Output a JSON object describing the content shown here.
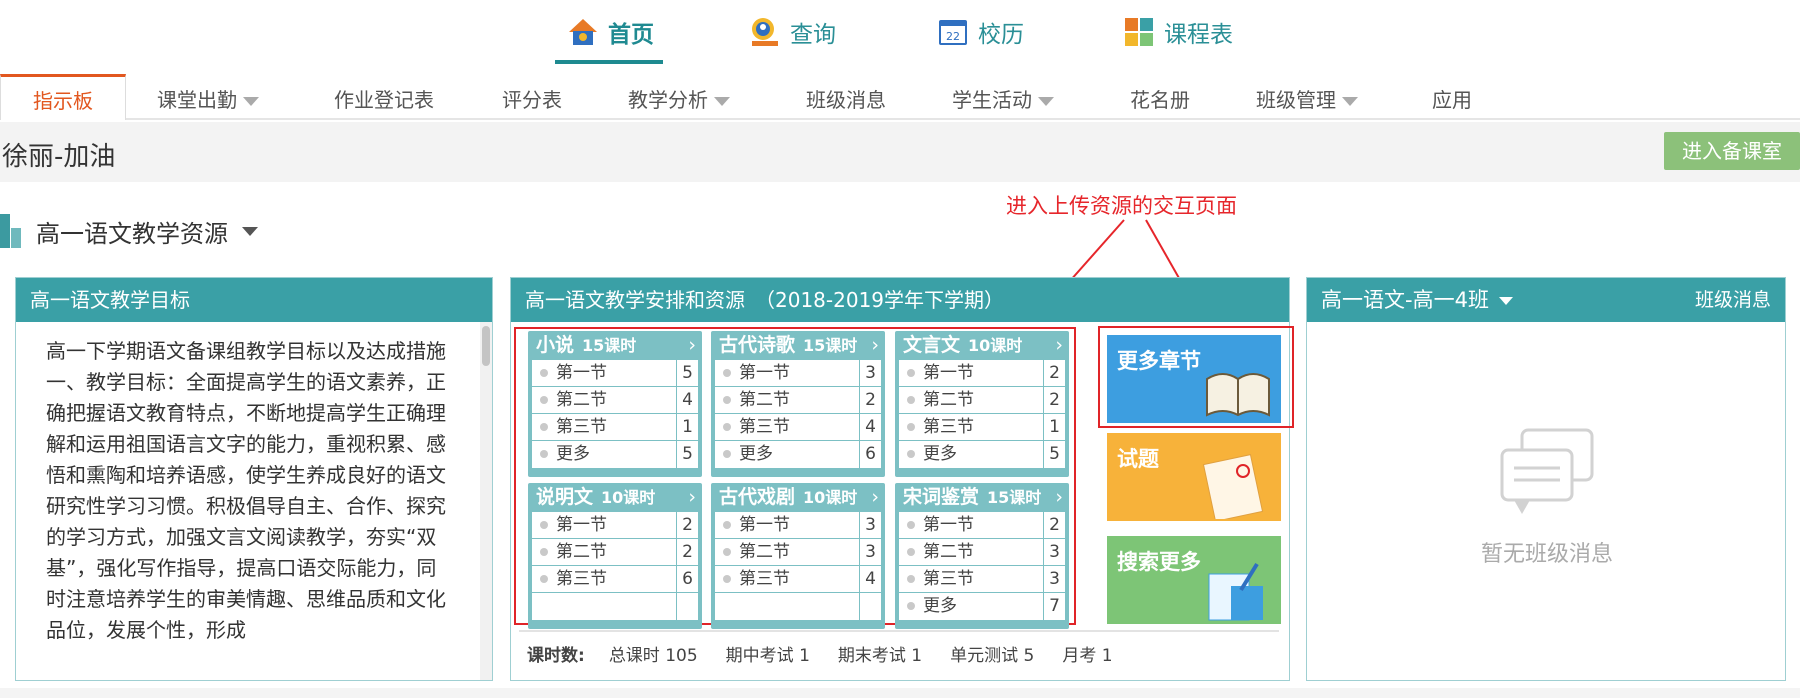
{
  "top_nav": [
    {
      "label": "首页",
      "icon": "home-icon",
      "active": true
    },
    {
      "label": "查询",
      "icon": "search-person-icon",
      "active": false
    },
    {
      "label": "校历",
      "icon": "calendar-icon",
      "active": false
    },
    {
      "label": "课程表",
      "icon": "schedule-icon",
      "active": false
    }
  ],
  "tabs": [
    {
      "label": "指示板",
      "active": true
    },
    {
      "label": "课堂出勤",
      "dropdown": true
    },
    {
      "label": "作业登记表"
    },
    {
      "label": "评分表"
    },
    {
      "label": "教学分析",
      "dropdown": true
    },
    {
      "label": "班级消息"
    },
    {
      "label": "学生活动",
      "dropdown": true
    },
    {
      "label": "花名册"
    },
    {
      "label": "班级管理",
      "dropdown": true
    },
    {
      "label": "应用"
    }
  ],
  "page_title": "徐丽-加油",
  "prep_button": "进入备课室",
  "resource_title": "高一语文教学资源",
  "annotation": "进入上传资源的交互页面",
  "goals_panel": {
    "title": "高一语文教学目标",
    "text": "高一下学期语文备课组教学目标以及达成措施\n一、教学目标：全面提高学生的语文素养，正确把握语文教育特点，不断地提高学生正确理解和运用祖国语言文字的能力，重视积累、感悟和熏陶和培养语感，使学生养成良好的语文研究性学习习惯。积极倡导自主、合作、探究的学习方式，加强文言文阅读教学，夯实“双基”，强化写作指导，提高口语交际能力，同时注意培养学生的审美情趣、思维品质和文化品位，发展个性，形成"
  },
  "plan_panel": {
    "title": "高一语文教学安排和资源　（2018-2019学年下学期）",
    "courses": [
      {
        "name": "小说",
        "hours": "15课时",
        "rows": [
          {
            "n": "第一节",
            "c": "5"
          },
          {
            "n": "第二节",
            "c": "4"
          },
          {
            "n": "第三节",
            "c": "1"
          },
          {
            "n": "更多",
            "c": "5"
          }
        ]
      },
      {
        "name": "古代诗歌",
        "hours": "15课时",
        "rows": [
          {
            "n": "第一节",
            "c": "3"
          },
          {
            "n": "第二节",
            "c": "2"
          },
          {
            "n": "第三节",
            "c": "4"
          },
          {
            "n": "更多",
            "c": "6"
          }
        ]
      },
      {
        "name": "文言文",
        "hours": "10课时",
        "rows": [
          {
            "n": "第一节",
            "c": "2"
          },
          {
            "n": "第二节",
            "c": "2"
          },
          {
            "n": "第三节",
            "c": "1"
          },
          {
            "n": "更多",
            "c": "5"
          }
        ]
      },
      {
        "name": "说明文",
        "hours": "10课时",
        "rows": [
          {
            "n": "第一节",
            "c": "2"
          },
          {
            "n": "第二节",
            "c": "2"
          },
          {
            "n": "第三节",
            "c": "6"
          },
          {
            "n": "",
            "c": ""
          }
        ]
      },
      {
        "name": "古代戏剧",
        "hours": "10课时",
        "rows": [
          {
            "n": "第一节",
            "c": "3"
          },
          {
            "n": "第二节",
            "c": "3"
          },
          {
            "n": "第三节",
            "c": "4"
          },
          {
            "n": "",
            "c": ""
          }
        ]
      },
      {
        "name": "宋词鉴赏",
        "hours": "15课时",
        "rows": [
          {
            "n": "第一节",
            "c": "2"
          },
          {
            "n": "第二节",
            "c": "3"
          },
          {
            "n": "第三节",
            "c": "3"
          },
          {
            "n": "更多",
            "c": "7"
          }
        ]
      }
    ],
    "tiles": [
      "更多章节",
      "试题",
      "搜索更多"
    ],
    "stats": {
      "label": "课时数:",
      "items": [
        "总课时 105",
        "期中考试 1",
        "期末考试 1",
        "单元测试 5",
        "月考 1"
      ]
    }
  },
  "class_panel": {
    "title": "高一语文-高一4班",
    "link": "班级消息",
    "empty_text": "暂无班级消息"
  },
  "colors": {
    "teal": "#3aa0a6",
    "accent": "#e2571f",
    "annotation": "#e6262b"
  }
}
